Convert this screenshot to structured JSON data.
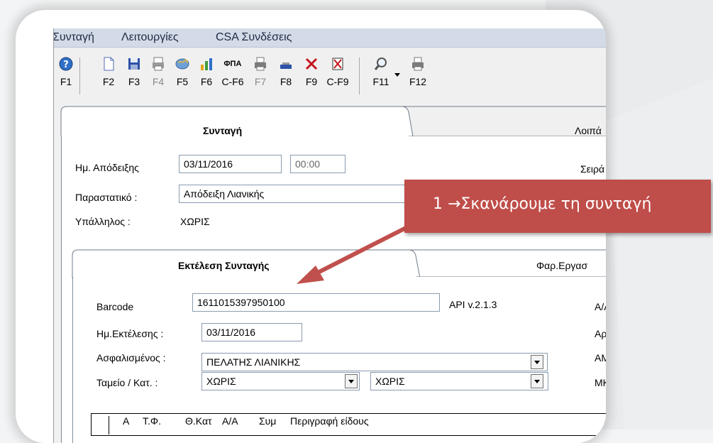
{
  "menu": {
    "items": [
      "Συνταγή",
      "Λειτουργίες",
      "CSA Συνδέσεις"
    ]
  },
  "toolbar": {
    "buttons": [
      {
        "label": "F1",
        "icon": "help-icon"
      },
      {
        "label": "F2",
        "icon": "new-document-icon"
      },
      {
        "label": "F3",
        "icon": "save-icon"
      },
      {
        "label": "F4",
        "icon": "print-form-icon"
      },
      {
        "label": "F5",
        "icon": "globe-icon"
      },
      {
        "label": "F6",
        "icon": "bar-chart-icon"
      },
      {
        "label": "C-F6",
        "icon": "vat-icon",
        "icon_text": "ΦΠΑ"
      },
      {
        "label": "F7",
        "icon": "printer-icon"
      },
      {
        "label": "F8",
        "icon": "card-reader-icon"
      },
      {
        "label": "F9",
        "icon": "delete-icon"
      },
      {
        "label": "C-F9",
        "icon": "delete-document-icon"
      },
      {
        "label": "F11",
        "icon": "search-icon"
      },
      {
        "label": "F12",
        "icon": "printer-icon"
      }
    ]
  },
  "outer_tabs": {
    "active": "Συνταγή",
    "other": "Λοιπά"
  },
  "form": {
    "receipt_date_label": "Ημ. Απόδειξης",
    "receipt_date": "03/11/2016",
    "receipt_time": "00:00",
    "series_label": "Σειρά",
    "document_label": "Παραστατικό :",
    "document_value": "Απόδειξη Λιανικής",
    "employee_label": "Υπάλληλος :",
    "employee_value": "ΧΩΡΙΣ"
  },
  "inner_tabs": {
    "active": "Εκτέλεση Συνταγής",
    "other": "Φαρ.Εργασ"
  },
  "execution": {
    "barcode_label": "Barcode",
    "barcode_value": "1611015397950100",
    "api_version": "API v.2.1.3",
    "aa_label": "Α/Α",
    "exec_date_label": "Ημ.Εκτέλεσης :",
    "exec_date": "03/11/2016",
    "ar_label": "Αρ.",
    "insured_label": "Ασφαλισμένος :",
    "insured_value": "ΠΕΛΑΤΗΣ ΛΙΑΝΙΚΗΣ",
    "am_label": "ΑΜ",
    "fund_label": "Ταμείο / Κατ. :",
    "fund_value": "ΧΩΡΙΣ",
    "category_value": "ΧΩΡΙΣ",
    "mk_label": "ΜΚ"
  },
  "grid": {
    "headers": [
      "Α",
      "Τ.Φ.",
      "Θ.Κατ",
      "Α/Α",
      "Συμ",
      "Περιγραφή είδους"
    ]
  },
  "callout": {
    "text": "1 →Σκανάρουμε τη συνταγή"
  },
  "colors": {
    "callout": "#bf4d49",
    "arrow": "#c0504d",
    "menubar": "#d4dbe8"
  }
}
